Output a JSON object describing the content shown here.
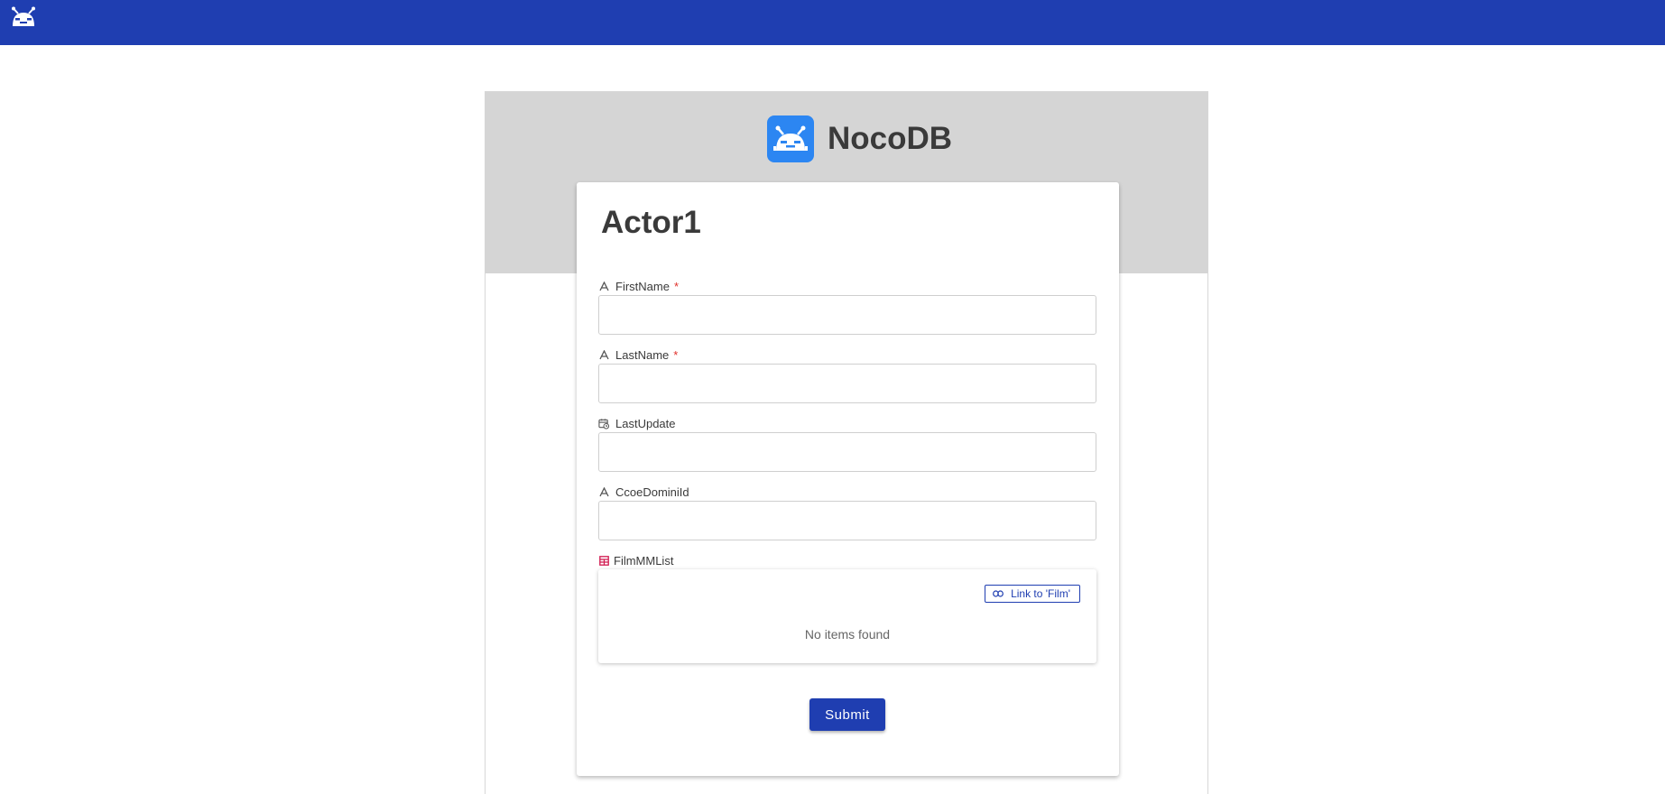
{
  "app": {
    "name": "NocoDB",
    "accent": "#1f3eb1",
    "logo_icon": "nocodb-robot-icon"
  },
  "form": {
    "title": "Actor1",
    "fields": [
      {
        "label": "FirstName",
        "required_mark": "*",
        "icon": "text-type-icon",
        "value": ""
      },
      {
        "label": "LastName",
        "required_mark": "*",
        "icon": "text-type-icon",
        "value": ""
      },
      {
        "label": "LastUpdate",
        "icon": "calendar-clock-icon",
        "value": ""
      },
      {
        "label": "CcoeDominiId",
        "icon": "text-type-icon",
        "value": ""
      }
    ],
    "link_field": {
      "label": "FilmMMList",
      "icon": "table-link-icon",
      "link_button": "Link to 'Film'",
      "empty_text": "No items found"
    },
    "submit_label": "Submit"
  }
}
